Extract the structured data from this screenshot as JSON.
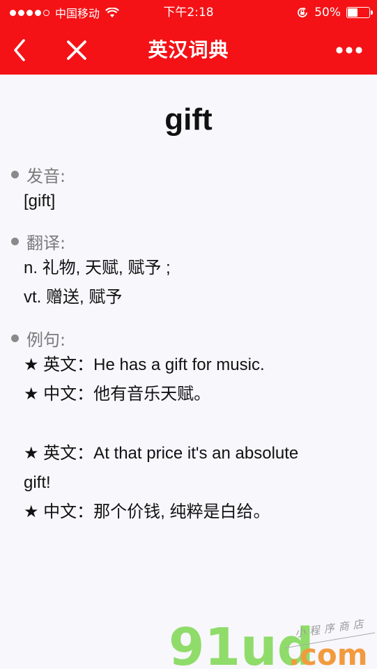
{
  "status": {
    "carrier": "中国移动",
    "time": "下午2:18",
    "battery": "50%",
    "battery_level": 0.5
  },
  "nav": {
    "title": "英汉词典"
  },
  "entry": {
    "word": "gift",
    "pronunciation_label": "发音:",
    "pronunciation": "[gift]",
    "translation_label": "翻译:",
    "translations": [
      "n. 礼物, 天赋, 赋予 ;",
      "vt. 赠送, 赋予"
    ],
    "examples_label": "例句:",
    "examples": [
      {
        "en": "★ 英文：He has a gift for music.",
        "zh": "★ 中文：他有音乐天赋。"
      },
      {
        "en_line1": "★ 英文：At that price it's an absolute",
        "en_line2": "gift!",
        "zh": "★ 中文：那个价钱, 纯粹是白给。"
      }
    ]
  },
  "watermark": {
    "logo_text": "91ud.com",
    "tagline": "小程序商店"
  },
  "colors": {
    "accent": "#f41216",
    "background": "#f8f7fc",
    "watermark_green": "#8fdc6a",
    "watermark_orange": "#f29a3e"
  }
}
